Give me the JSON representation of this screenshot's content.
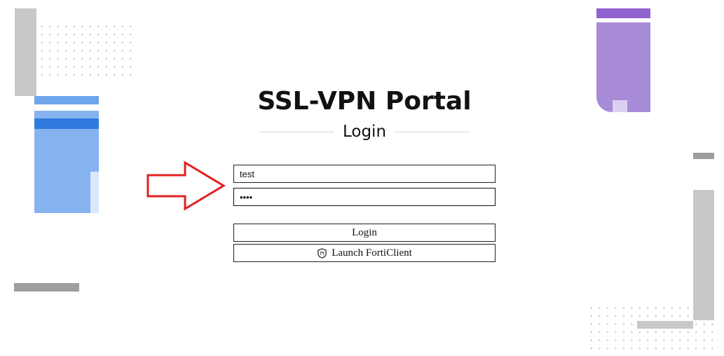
{
  "title": "SSL-VPN Portal",
  "subtitle": "Login",
  "form": {
    "username_value": "test",
    "password_value": "test"
  },
  "buttons": {
    "login_label": "Login",
    "forticlient_label": "Launch FortiClient"
  },
  "icons": {
    "forticlient": "shield-icon",
    "annotation": "red-arrow-icon"
  },
  "colors": {
    "annotation_arrow": "#e02020",
    "accent_blue": "#2f7be0",
    "accent_purple": "#9163cf"
  }
}
